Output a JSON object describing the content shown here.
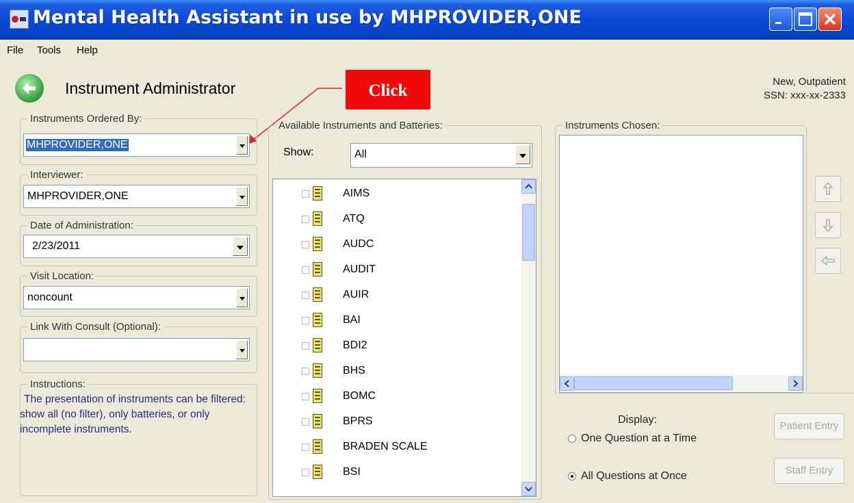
{
  "window": {
    "title": "Mental Health Assistant in use by MHPROVIDER,ONE",
    "controls": [
      "minimize",
      "maximize",
      "close"
    ]
  },
  "menu": {
    "file": "File",
    "tools": "Tools",
    "help": "Help"
  },
  "header": {
    "title": "Instrument Administrator",
    "patient_status": "New, Outpatient",
    "ssn": "SSN: xxx-xx-2333"
  },
  "annotation": {
    "label": "Click"
  },
  "left": {
    "ordered_by": {
      "legend": "Instruments Ordered By:",
      "value": "MHPROVIDER,ONE"
    },
    "interviewer": {
      "legend": "Interviewer:",
      "value": "MHPROVIDER,ONE"
    },
    "date": {
      "legend": "Date of Administration:",
      "value": "2/23/2011"
    },
    "location": {
      "legend": "Visit Location:",
      "value": "noncount"
    },
    "consult": {
      "legend": "Link With Consult (Optional):",
      "value": ""
    },
    "instructions": {
      "legend": "Instructions:",
      "text": "The presentation of instruments can be filtered: show all (no filter), only batteries, or only incomplete instruments."
    }
  },
  "available": {
    "legend": "Available Instruments and Batteries:",
    "show_label": "Show:",
    "show_value": "All",
    "items": [
      "AIMS",
      "ATQ",
      "AUDC",
      "AUDIT",
      "AUIR",
      "BAI",
      "BDI2",
      "BHS",
      "BOMC",
      "BPRS",
      "BRADEN SCALE",
      "BSI"
    ]
  },
  "chosen": {
    "legend": "Instruments Chosen:",
    "items": []
  },
  "bottom": {
    "display_label": "Display:",
    "option_one": "One Question at a Time",
    "option_all": "All Questions at Once",
    "selected": "All Questions at Once",
    "patient_entry": "Patient Entry",
    "staff_entry": "Staff Entry"
  },
  "colors": {
    "title_bar": "#0a4ad8",
    "annotation": "#f00a0a",
    "selection": "#316ac5",
    "instructions_text": "#2a2a8c"
  }
}
